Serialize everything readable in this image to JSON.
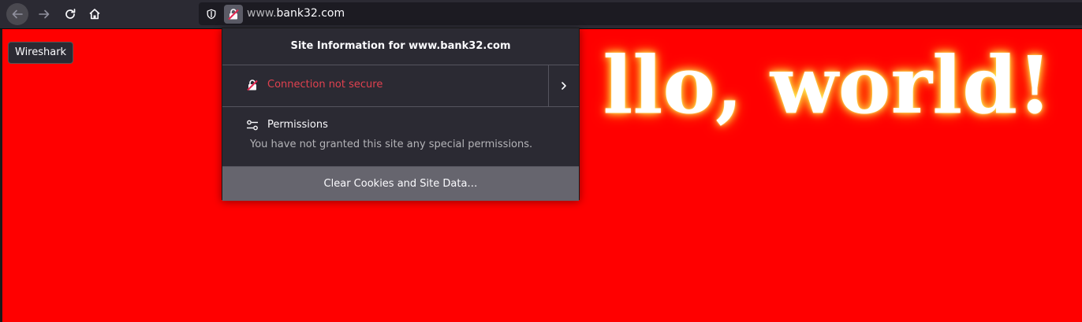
{
  "toolbar": {
    "url_prefix": "www.",
    "url_domain": "bank32.com"
  },
  "page": {
    "badge_label": "Wireshark",
    "heading": "llo, world!",
    "background_color": "#ff0000"
  },
  "popup": {
    "title": "Site Information for www.bank32.com",
    "connection_label": "Connection not secure",
    "permissions_title": "Permissions",
    "permissions_desc": "You have not granted this site any special permissions.",
    "clear_button_label": "Clear Cookies and Site Data…",
    "warning_color": "#e0414f"
  },
  "icons": [
    "arrow-left-icon",
    "arrow-right-icon",
    "reload-icon",
    "home-icon",
    "shield-icon",
    "insecure-lock-icon",
    "chevron-right-icon",
    "permissions-sliders-icon"
  ]
}
